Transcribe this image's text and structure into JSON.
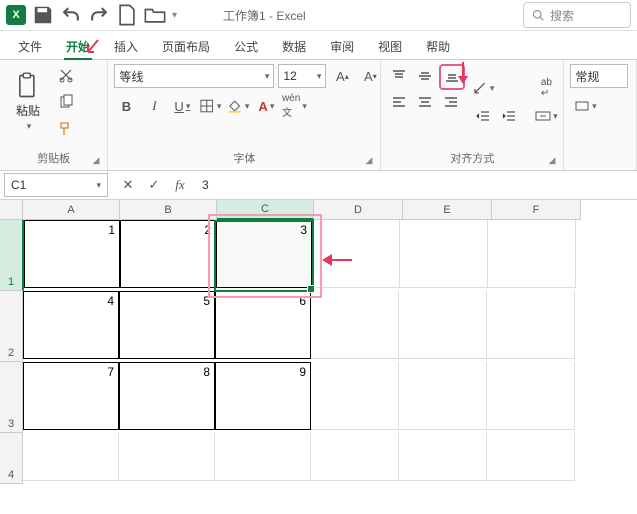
{
  "title": "工作簿1 - Excel",
  "search_placeholder": "搜索",
  "tabs": [
    "文件",
    "开始",
    "插入",
    "页面布局",
    "公式",
    "数据",
    "审阅",
    "视图",
    "帮助"
  ],
  "active_tab": 1,
  "ribbon": {
    "clipboard": {
      "label": "剪贴板",
      "paste": "粘贴"
    },
    "font": {
      "label": "字体",
      "name": "等线",
      "size": "12"
    },
    "align": {
      "label": "对齐方式"
    },
    "number_group": "常规"
  },
  "namebox": "C1",
  "formula": "3",
  "columns": [
    "A",
    "B",
    "C",
    "D",
    "E",
    "F"
  ],
  "rows": [
    "1",
    "2",
    "3",
    "4"
  ],
  "cells": {
    "r1": {
      "A": "1",
      "B": "2",
      "C": "3"
    },
    "r2": {
      "A": "4",
      "B": "5",
      "C": "6"
    },
    "r3": {
      "A": "7",
      "B": "8",
      "C": "9"
    }
  }
}
